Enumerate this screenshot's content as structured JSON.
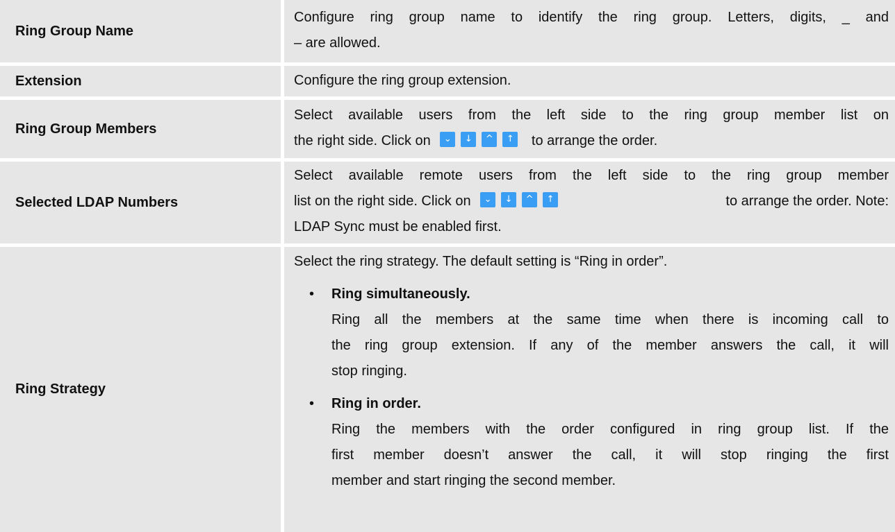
{
  "rows": [
    {
      "label": "Ring Group Name",
      "desc_lines": [
        "Configure ring group name to identify the ring group. Letters, digits, _ and",
        "– are allowed."
      ]
    },
    {
      "label": "Extension",
      "desc_lines": [
        "Configure the ring group extension."
      ]
    },
    {
      "label": "Ring Group Members",
      "line1": "Select available users from the left side to the ring group member list on",
      "line2_pre": "the right side. Click on",
      "line2_post": "to arrange the order."
    },
    {
      "label": "Selected LDAP Numbers",
      "line1": "Select available remote users from the left side to the ring group member",
      "line2_pre": "list on the right side. Click on",
      "line2_post": "to arrange the order. Note:",
      "line3": "LDAP Sync must be enabled first."
    },
    {
      "label": "Ring Strategy",
      "intro": "Select the ring strategy. The default setting is “Ring in order”.",
      "options": [
        {
          "title": "Ring simultaneously.",
          "lines": [
            "Ring all the members at the same time when there is incoming call to",
            "the ring group extension. If any of the member answers the call, it will",
            "stop ringing."
          ]
        },
        {
          "title": "Ring in order.",
          "lines": [
            "Ring the members with the order configured in ring group list. If the",
            "first member doesn’t answer the call, it will stop ringing the first",
            "member and start ringing the second member."
          ]
        }
      ]
    }
  ],
  "order_buttons": [
    {
      "icon": "chevron-down-icon",
      "glyph": "⌄"
    },
    {
      "icon": "arrow-down-icon",
      "glyph": "↓"
    },
    {
      "icon": "chevron-up-icon",
      "glyph": "^"
    },
    {
      "icon": "arrow-up-icon",
      "glyph": "↑"
    }
  ],
  "colors": {
    "cell_bg": "#e6e6e6",
    "button_bg": "#3a9ef5"
  }
}
